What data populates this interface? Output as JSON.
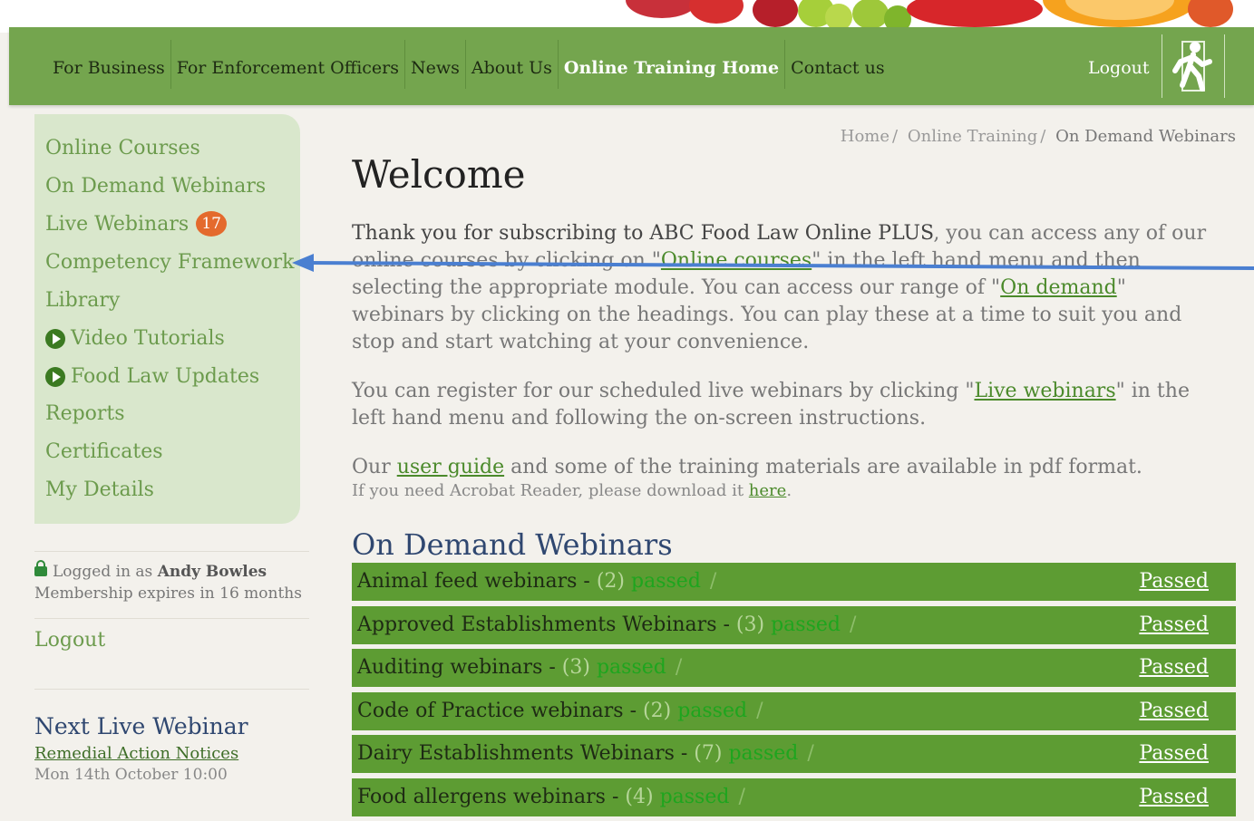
{
  "nav": {
    "items": [
      {
        "label": "For Business",
        "active": false
      },
      {
        "label": "For Enforcement Officers",
        "active": false
      },
      {
        "label": "News",
        "active": false
      },
      {
        "label": "About Us",
        "active": false
      },
      {
        "label": "Online Training Home",
        "active": true
      },
      {
        "label": "Contact us",
        "active": false
      }
    ],
    "logout_label": "Logout"
  },
  "sidebar": {
    "items": [
      {
        "label": "Online Courses"
      },
      {
        "label": "On Demand Webinars"
      },
      {
        "label": "Live Webinars",
        "badge": "17"
      },
      {
        "label": "Competency Framework"
      },
      {
        "label": "Library"
      },
      {
        "label": "Video Tutorials",
        "icon": "play-circle-icon"
      },
      {
        "label": "Food Law Updates",
        "icon": "play-circle-icon"
      },
      {
        "label": "Reports"
      },
      {
        "label": "Certificates"
      },
      {
        "label": "My Details"
      }
    ],
    "login": {
      "prefix": "Logged in as",
      "user": "Andy Bowles",
      "expiry": "Membership expires in 16 months"
    },
    "logout_label": "Logout",
    "next_webinar": {
      "title": "Next Live Webinar",
      "link": "Remedial Action Notices",
      "date": "Mon 14th October 10:00"
    }
  },
  "breadcrumb": [
    "Home",
    "Online Training",
    "On Demand Webinars"
  ],
  "main": {
    "title": "Welcome",
    "p1": {
      "bold": "Thank you for subscribing to ABC Food Law Online PLUS",
      "t1": ", you can access any of our online courses by clicking on \"",
      "link1": "Online courses",
      "t2": "\" in the left hand menu and then selecting the appropriate module. You can access our range of \"",
      "link2": "On demand",
      "t3": "\" webinars by clicking on the headings. You can play these at a time to suit you and stop and start watching at your convenience."
    },
    "p2": {
      "t1": "You can register for our scheduled live webinars by clicking \"",
      "link": "Live webinars",
      "t2": "\" in the left hand menu and following the on-screen instructions."
    },
    "p3": {
      "t1": "Our ",
      "link": "user guide",
      "t2": " and some of the training materials are available in pdf format."
    },
    "p4": {
      "t1": "If you need Acrobat Reader, please download it ",
      "link": "here",
      "t2": "."
    },
    "section_title": "On Demand Webinars",
    "webinars": [
      {
        "name": "Animal feed webinars",
        "count": "(2)",
        "passed": "passed",
        "status": "Passed"
      },
      {
        "name": "Approved Establishments Webinars",
        "count": "(3)",
        "passed": "passed",
        "status": "Passed"
      },
      {
        "name": "Auditing webinars",
        "count": "(3)",
        "passed": "passed",
        "status": "Passed"
      },
      {
        "name": "Code of Practice webinars",
        "count": "(2)",
        "passed": "passed",
        "status": "Passed"
      },
      {
        "name": "Dairy Establishments Webinars",
        "count": "(7)",
        "passed": "passed",
        "status": "Passed"
      },
      {
        "name": "Food allergens webinars",
        "count": "(4)",
        "passed": "passed",
        "status": "Passed"
      }
    ]
  },
  "colors": {
    "nav_green": "#74a54e",
    "row_green": "#5d9c33",
    "sidebar_bg": "#d9e7cc",
    "badge": "#e46a2d",
    "title_blue": "#2f4770",
    "arrow": "#4a7fd1"
  }
}
